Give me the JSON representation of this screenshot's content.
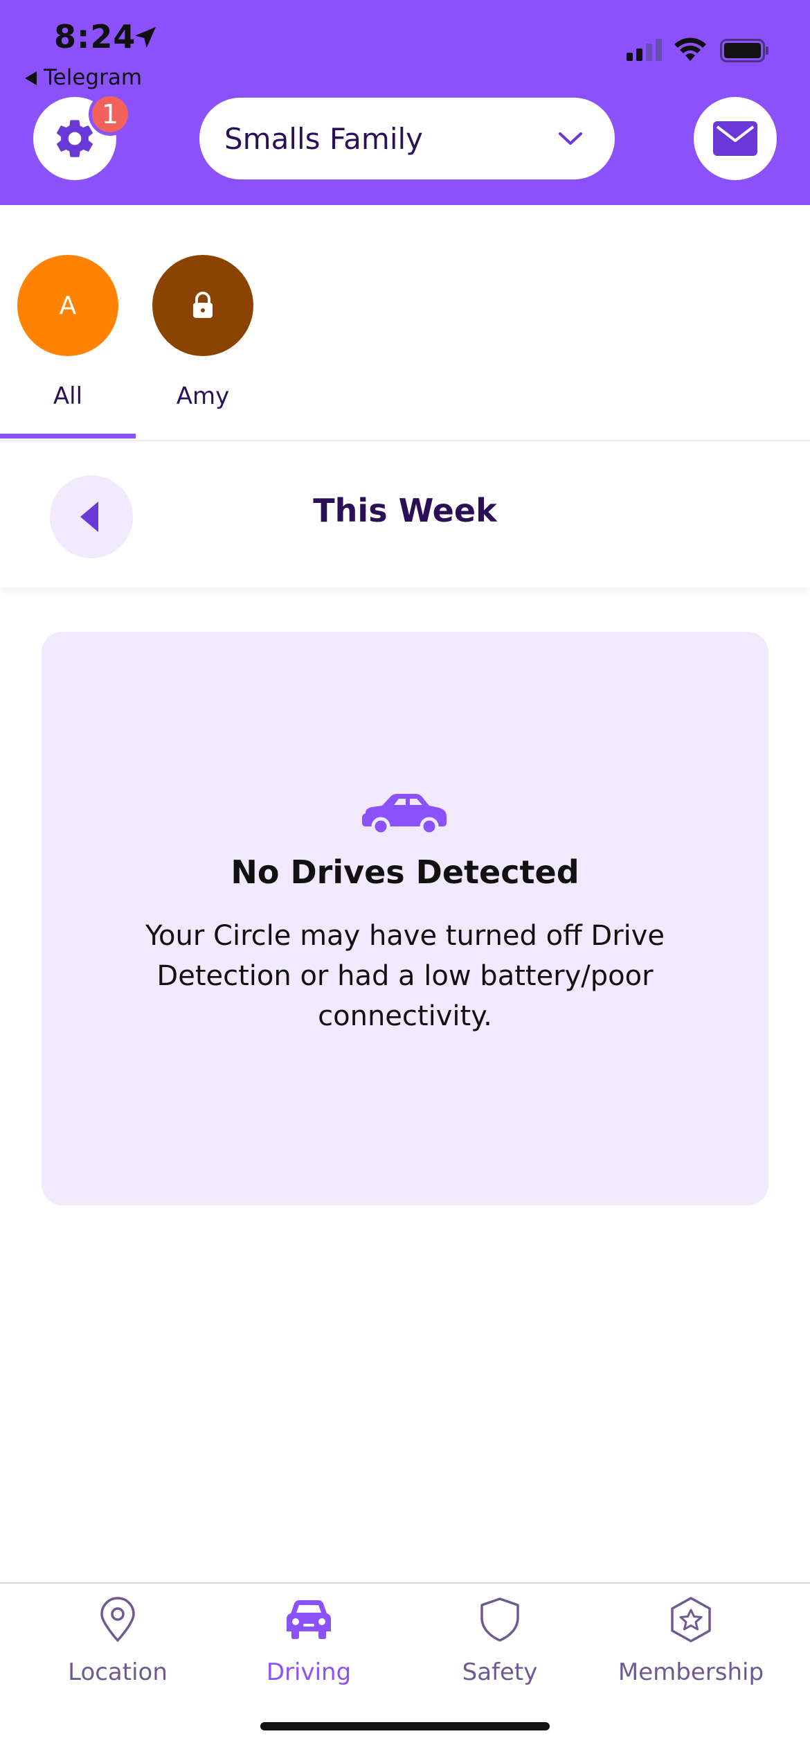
{
  "status_bar": {
    "time": "8:24",
    "back_app": "Telegram"
  },
  "header": {
    "settings_badge": "1",
    "circle_name": "Smalls Family"
  },
  "members": [
    {
      "initial": "A",
      "name": "All",
      "color": "#ff8200",
      "selected": true
    },
    {
      "initial": "",
      "name": "Amy",
      "color": "#8a4300",
      "locked": true,
      "selected": false
    }
  ],
  "week": {
    "title": "This Week"
  },
  "empty_state": {
    "icon": "car-icon",
    "title": "No Drives Detected",
    "message": "Your Circle may have turned off Drive Detection or had a low battery/poor connectivity."
  },
  "bottom_nav": {
    "items": [
      {
        "label": "Location",
        "icon": "location-pin-icon",
        "active": false
      },
      {
        "label": "Driving",
        "icon": "car-icon",
        "active": true
      },
      {
        "label": "Safety",
        "icon": "shield-icon",
        "active": false
      },
      {
        "label": "Membership",
        "icon": "star-badge-icon",
        "active": false
      }
    ]
  },
  "colors": {
    "primary": "#8b52fb",
    "dark_text": "#2b0f57",
    "card_bg": "#f1e9fc",
    "inactive_nav": "#6f5a8f",
    "badge": "#f1625b"
  }
}
